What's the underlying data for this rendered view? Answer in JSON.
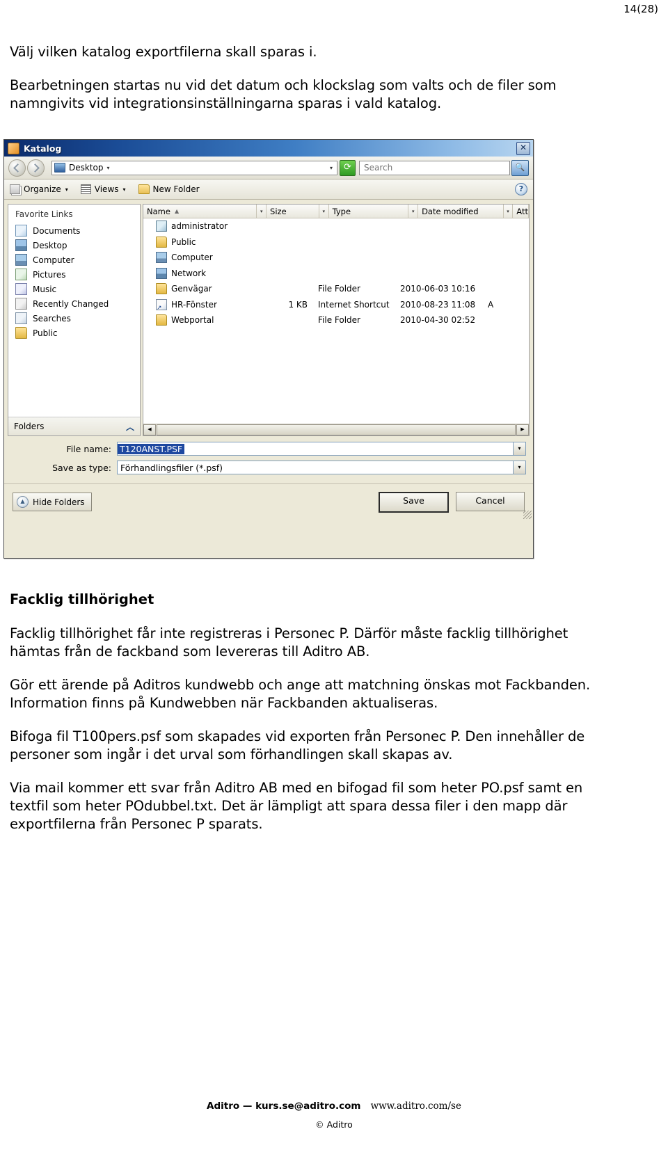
{
  "page": {
    "number": "14(28)"
  },
  "doc": {
    "intro1": "Välj vilken katalog exportfilerna skall sparas i.",
    "intro2": "Bearbetningen startas nu vid det datum och klockslag som valts och de filer som namngivits vid integrationsinställningarna sparas i vald katalog.",
    "section_heading": "Facklig tillhörighet",
    "p1": "Facklig tillhörighet får inte registreras i Personec P. Därför måste facklig tillhörighet hämtas från de fackband som levereras till Aditro AB.",
    "p2": "Gör ett ärende på Aditros kundwebb och ange att matchning önskas mot Fackbanden. Information finns på Kundwebben när Fackbanden aktualiseras.",
    "p3": "Bifoga fil T100pers.psf som skapades vid exporten från Personec P. Den innehåller de personer som ingår i det urval som förhandlingen skall skapas av.",
    "p4": "Via mail kommer ett svar från Aditro AB med en bifogad fil som heter PO.psf samt en textfil som heter POdubbel.txt. Det är lämpligt att spara dessa filer i den mapp där exportfilerna från Personec P sparats."
  },
  "footer": {
    "company": "Aditro",
    "dash": "—",
    "email": "kurs.se@aditro.com",
    "website": "www.aditro.com/se",
    "copyright": "© Aditro"
  },
  "dialog": {
    "title": "Katalog",
    "close_label": "✕",
    "nav": {
      "back_label": "",
      "forward_label": "",
      "address_value": "Desktop",
      "address_caret": "▾",
      "address_dropdown": "▾",
      "refresh_label": "⟳",
      "search_placeholder": "Search",
      "search_value": "",
      "search_button_label": "🔍"
    },
    "commands": {
      "organize": "Organize",
      "organize_caret": "▾",
      "views": "Views",
      "views_caret": "▾",
      "new_folder": "New Folder",
      "help_label": "?"
    },
    "sidebar": {
      "title": "Favorite Links",
      "items": [
        {
          "label": "Documents",
          "icon": "document-icon"
        },
        {
          "label": "Desktop",
          "icon": "desktop-icon"
        },
        {
          "label": "Computer",
          "icon": "computer-icon"
        },
        {
          "label": "Pictures",
          "icon": "pictures-icon"
        },
        {
          "label": "Music",
          "icon": "music-icon"
        },
        {
          "label": "Recently Changed",
          "icon": "recent-icon"
        },
        {
          "label": "Searches",
          "icon": "search-folder-icon"
        },
        {
          "label": "Public",
          "icon": "folder-icon"
        }
      ],
      "folders_label": "Folders",
      "folders_chevron": "︿"
    },
    "filelist": {
      "columns": [
        {
          "label": "Name",
          "sort": "▲"
        },
        {
          "label": "Size",
          "sort": ""
        },
        {
          "label": "Type",
          "sort": ""
        },
        {
          "label": "Date modified",
          "sort": ""
        },
        {
          "label": "Att",
          "sort": ""
        }
      ],
      "col_filter_glyph": "▾",
      "rows": [
        {
          "name": "administrator",
          "icon": "user-folder-icon",
          "size": "",
          "type": "",
          "date": "",
          "att": ""
        },
        {
          "name": "Public",
          "icon": "folder-icon",
          "size": "",
          "type": "",
          "date": "",
          "att": ""
        },
        {
          "name": "Computer",
          "icon": "computer-icon",
          "size": "",
          "type": "",
          "date": "",
          "att": ""
        },
        {
          "name": "Network",
          "icon": "network-icon",
          "size": "",
          "type": "",
          "date": "",
          "att": ""
        },
        {
          "name": "Genvägar",
          "icon": "folder-icon",
          "size": "",
          "type": "File Folder",
          "date": "2010-06-03 10:16",
          "att": ""
        },
        {
          "name": "HR-Fönster",
          "icon": "shortcut-icon",
          "size": "1 KB",
          "type": "Internet Shortcut",
          "date": "2010-08-23 11:08",
          "att": "A"
        },
        {
          "name": "Webportal",
          "icon": "folder-icon",
          "size": "",
          "type": "File Folder",
          "date": "2010-04-30 02:52",
          "att": ""
        }
      ],
      "scroll_left": "◀",
      "scroll_right": "▶"
    },
    "fields": {
      "filename_label": "File name:",
      "filename_value": "T120ANST.PSF",
      "filetype_label": "Save as type:",
      "filetype_value": "Förhandlingsfiler (*.psf)",
      "dropdown_glyph": "▾"
    },
    "buttons": {
      "hide_folders": "Hide Folders",
      "hide_folders_glyph": "▲",
      "save": "Save",
      "cancel": "Cancel"
    }
  }
}
